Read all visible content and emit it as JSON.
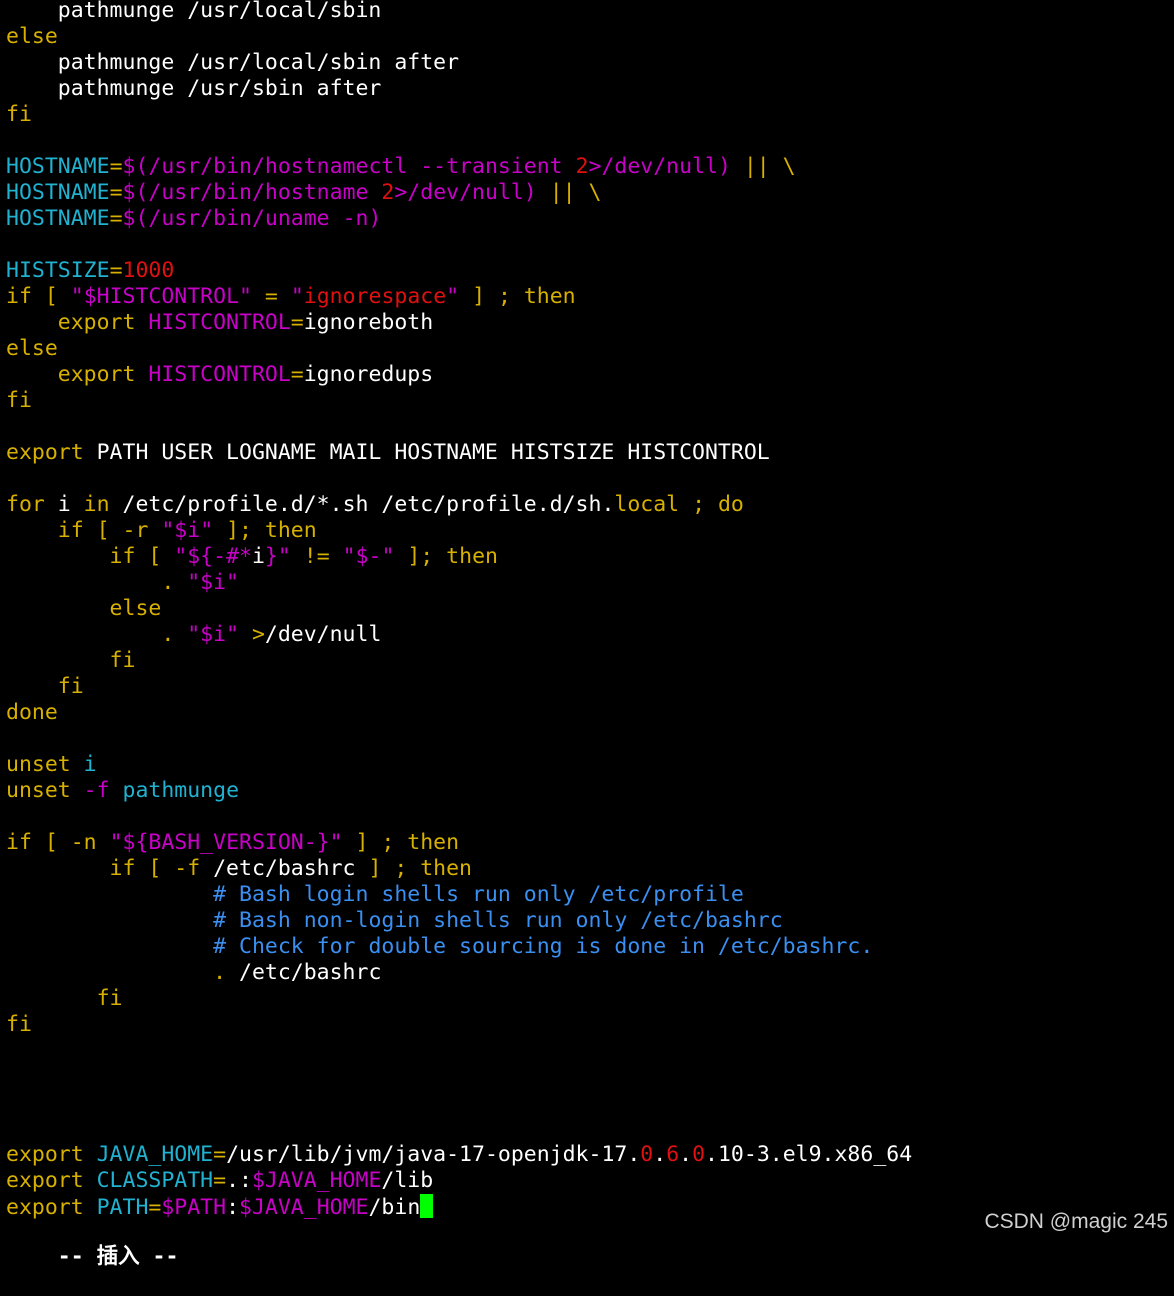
{
  "colors": {
    "background": "#000000",
    "default": "#ffffff",
    "keyword": "#d7b000",
    "variable": "#20b2d0",
    "special": "#c800c8",
    "number": "#e01010",
    "comment": "#3a8ff0",
    "cursor": "#00ff00"
  },
  "editor": {
    "lines": [
      [
        {
          "t": "    pathmunge /usr/local/sbin",
          "c": "default"
        }
      ],
      [
        {
          "t": "else",
          "c": "keyword"
        }
      ],
      [
        {
          "t": "    pathmunge /usr/local/sbin after",
          "c": "default"
        }
      ],
      [
        {
          "t": "    pathmunge /usr/sbin after",
          "c": "default"
        }
      ],
      [
        {
          "t": "fi",
          "c": "keyword"
        }
      ],
      [],
      [
        {
          "t": "HOSTNAME",
          "c": "variable"
        },
        {
          "t": "=",
          "c": "keyword"
        },
        {
          "t": "$(/usr/bin/hostnamectl --transient ",
          "c": "special"
        },
        {
          "t": "2",
          "c": "number"
        },
        {
          "t": ">/dev/null)",
          "c": "special"
        },
        {
          "t": " || \\",
          "c": "keyword"
        }
      ],
      [
        {
          "t": "HOSTNAME",
          "c": "variable"
        },
        {
          "t": "=",
          "c": "keyword"
        },
        {
          "t": "$(/usr/bin/hostname ",
          "c": "special"
        },
        {
          "t": "2",
          "c": "number"
        },
        {
          "t": ">/dev/null)",
          "c": "special"
        },
        {
          "t": " || \\",
          "c": "keyword"
        }
      ],
      [
        {
          "t": "HOSTNAME",
          "c": "variable"
        },
        {
          "t": "=",
          "c": "keyword"
        },
        {
          "t": "$(/usr/bin/uname -n)",
          "c": "special"
        }
      ],
      [],
      [
        {
          "t": "HISTSIZE",
          "c": "variable"
        },
        {
          "t": "=",
          "c": "keyword"
        },
        {
          "t": "1000",
          "c": "number"
        }
      ],
      [
        {
          "t": "if [ ",
          "c": "keyword"
        },
        {
          "t": "\"",
          "c": "special"
        },
        {
          "t": "$HISTCONTROL",
          "c": "special"
        },
        {
          "t": "\"",
          "c": "special"
        },
        {
          "t": " = ",
          "c": "keyword"
        },
        {
          "t": "\"",
          "c": "special"
        },
        {
          "t": "ignorespace",
          "c": "number"
        },
        {
          "t": "\"",
          "c": "special"
        },
        {
          "t": " ] ; then",
          "c": "keyword"
        }
      ],
      [
        {
          "t": "    export ",
          "c": "keyword"
        },
        {
          "t": "HISTCONTROL",
          "c": "special"
        },
        {
          "t": "=",
          "c": "keyword"
        },
        {
          "t": "ignoreboth",
          "c": "default"
        }
      ],
      [
        {
          "t": "else",
          "c": "keyword"
        }
      ],
      [
        {
          "t": "    export ",
          "c": "keyword"
        },
        {
          "t": "HISTCONTROL",
          "c": "special"
        },
        {
          "t": "=",
          "c": "keyword"
        },
        {
          "t": "ignoredups",
          "c": "default"
        }
      ],
      [
        {
          "t": "fi",
          "c": "keyword"
        }
      ],
      [],
      [
        {
          "t": "export ",
          "c": "keyword"
        },
        {
          "t": "PATH USER LOGNAME MAIL HOSTNAME HISTSIZE HISTCONTROL",
          "c": "default"
        }
      ],
      [],
      [
        {
          "t": "for ",
          "c": "keyword"
        },
        {
          "t": "i ",
          "c": "default"
        },
        {
          "t": "in ",
          "c": "keyword"
        },
        {
          "t": "/etc/profile.d/*.sh /etc/profile.d/sh.",
          "c": "default"
        },
        {
          "t": "local",
          "c": "keyword"
        },
        {
          "t": " ; do",
          "c": "keyword"
        }
      ],
      [
        {
          "t": "    if [ -r ",
          "c": "keyword"
        },
        {
          "t": "\"",
          "c": "special"
        },
        {
          "t": "$i",
          "c": "special"
        },
        {
          "t": "\"",
          "c": "special"
        },
        {
          "t": " ]; then",
          "c": "keyword"
        }
      ],
      [
        {
          "t": "        if [ ",
          "c": "keyword"
        },
        {
          "t": "\"",
          "c": "special"
        },
        {
          "t": "${-#*",
          "c": "special"
        },
        {
          "t": "i",
          "c": "default"
        },
        {
          "t": "}",
          "c": "special"
        },
        {
          "t": "\"",
          "c": "special"
        },
        {
          "t": " != ",
          "c": "keyword"
        },
        {
          "t": "\"",
          "c": "special"
        },
        {
          "t": "$-",
          "c": "special"
        },
        {
          "t": "\"",
          "c": "special"
        },
        {
          "t": " ]; then",
          "c": "keyword"
        }
      ],
      [
        {
          "t": "            . ",
          "c": "keyword"
        },
        {
          "t": "\"$i\"",
          "c": "special"
        }
      ],
      [
        {
          "t": "        else",
          "c": "keyword"
        }
      ],
      [
        {
          "t": "            . ",
          "c": "keyword"
        },
        {
          "t": "\"$i\"",
          "c": "special"
        },
        {
          "t": " >",
          "c": "keyword"
        },
        {
          "t": "/dev/null",
          "c": "default"
        }
      ],
      [
        {
          "t": "        fi",
          "c": "keyword"
        }
      ],
      [
        {
          "t": "    fi",
          "c": "keyword"
        }
      ],
      [
        {
          "t": "done",
          "c": "keyword"
        }
      ],
      [],
      [
        {
          "t": "unset ",
          "c": "keyword"
        },
        {
          "t": "i",
          "c": "variable"
        }
      ],
      [
        {
          "t": "unset ",
          "c": "keyword"
        },
        {
          "t": "-f ",
          "c": "special"
        },
        {
          "t": "pathmunge",
          "c": "variable"
        }
      ],
      [],
      [
        {
          "t": "if [ -n ",
          "c": "keyword"
        },
        {
          "t": "\"",
          "c": "special"
        },
        {
          "t": "${BASH_VERSION-}",
          "c": "special"
        },
        {
          "t": "\"",
          "c": "special"
        },
        {
          "t": " ] ; then",
          "c": "keyword"
        }
      ],
      [
        {
          "t": "        if [ -f ",
          "c": "keyword"
        },
        {
          "t": "/etc/bashrc",
          "c": "default"
        },
        {
          "t": " ] ; then",
          "c": "keyword"
        }
      ],
      [
        {
          "t": "                ",
          "c": "default"
        },
        {
          "t": "# Bash login shells run only /etc/profile",
          "c": "comment"
        }
      ],
      [
        {
          "t": "                ",
          "c": "default"
        },
        {
          "t": "# Bash non-login shells run only /etc/bashrc",
          "c": "comment"
        }
      ],
      [
        {
          "t": "                ",
          "c": "default"
        },
        {
          "t": "# Check for double sourcing is done in /etc/bashrc.",
          "c": "comment"
        }
      ],
      [
        {
          "t": "                . ",
          "c": "keyword"
        },
        {
          "t": "/etc/bashrc",
          "c": "default"
        }
      ],
      [
        {
          "t": "       fi",
          "c": "keyword"
        }
      ],
      [
        {
          "t": "fi",
          "c": "keyword"
        }
      ],
      [],
      [],
      [],
      [],
      [
        {
          "t": "export ",
          "c": "keyword"
        },
        {
          "t": "JAVA_HOME",
          "c": "variable"
        },
        {
          "t": "=",
          "c": "keyword"
        },
        {
          "t": "/usr/lib/jvm/java-17-openjdk-17.",
          "c": "default"
        },
        {
          "t": "0",
          "c": "number"
        },
        {
          "t": ".",
          "c": "default"
        },
        {
          "t": "6",
          "c": "number"
        },
        {
          "t": ".",
          "c": "default"
        },
        {
          "t": "0",
          "c": "number"
        },
        {
          "t": ".10-3.el9.x86_64",
          "c": "default"
        }
      ],
      [
        {
          "t": "export ",
          "c": "keyword"
        },
        {
          "t": "CLASSPATH",
          "c": "variable"
        },
        {
          "t": "=",
          "c": "keyword"
        },
        {
          "t": ".:",
          "c": "default"
        },
        {
          "t": "$JAVA_HOME",
          "c": "special"
        },
        {
          "t": "/lib",
          "c": "default"
        }
      ],
      [
        {
          "t": "export ",
          "c": "keyword"
        },
        {
          "t": "PATH",
          "c": "variable"
        },
        {
          "t": "=",
          "c": "keyword"
        },
        {
          "t": "$PATH",
          "c": "special"
        },
        {
          "t": ":",
          "c": "default"
        },
        {
          "t": "$JAVA_HOME",
          "c": "special"
        },
        {
          "t": "/bin",
          "c": "default"
        }
      ]
    ]
  },
  "status": {
    "mode": "-- 插入 --"
  },
  "watermark": "CSDN @magic 245"
}
